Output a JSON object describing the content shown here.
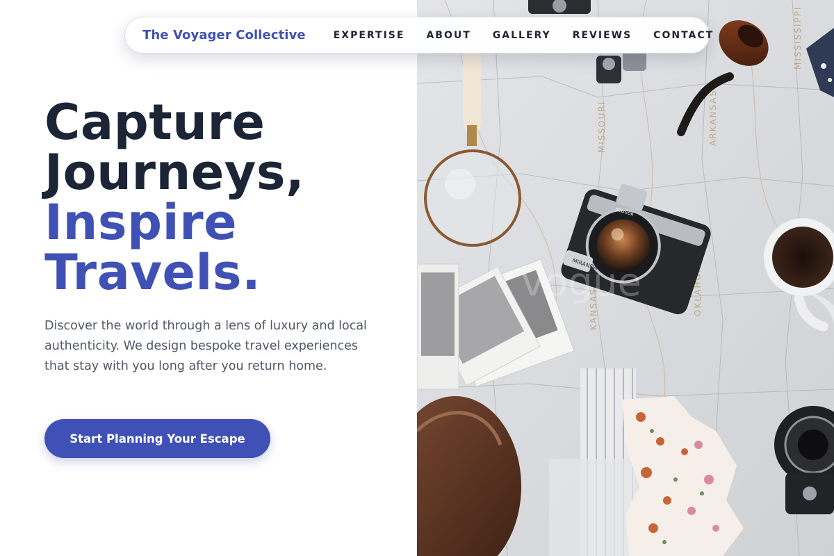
{
  "nav": {
    "brand": "The Voyager Collective",
    "links": [
      "EXPERTISE",
      "ABOUT",
      "GALLERY",
      "REVIEWS",
      "CONTACT"
    ]
  },
  "hero": {
    "headline_dark": [
      "Capture",
      "Journeys,"
    ],
    "headline_accent": [
      "Inspire",
      "Travels."
    ],
    "description": "Discover the world through a lens of luxury and local authenticity. We design bespoke travel experiences that stay with you long after you return home.",
    "cta_label": "Start Planning Your Escape"
  },
  "colors": {
    "accent": "#3f51b5",
    "heading_dark": "#1c2536",
    "body_text": "#4f5766",
    "background": "#ffffff"
  },
  "hero_image": {
    "map_labels": [
      "MISSOURI",
      "ARKANSAS",
      "OKLAHOMA",
      "MISSISSIPPI",
      "KANSAS"
    ],
    "camera_lens_text": "MIRANDA",
    "lens_ring_text": "SOLIGOR",
    "watermark": "vogue"
  }
}
